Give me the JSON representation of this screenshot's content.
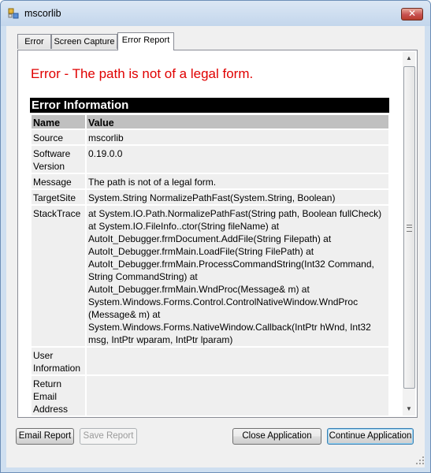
{
  "window": {
    "title": "mscorlib"
  },
  "tabs": [
    {
      "label": "Error"
    },
    {
      "label": "Screen Capture"
    },
    {
      "label": "Error Report"
    }
  ],
  "report": {
    "error_title": "Error - The path is not of a legal form.",
    "section_heading": "Error Information",
    "columns": [
      "Name",
      "Value"
    ],
    "rows": [
      {
        "name": "Source",
        "value": "mscorlib"
      },
      {
        "name": "Software Version",
        "value": "0.19.0.0"
      },
      {
        "name": "Message",
        "value": "The path is not of a legal form."
      },
      {
        "name": "TargetSite",
        "value": "System.String NormalizePathFast(System.String, Boolean)"
      },
      {
        "name": "StackTrace",
        "value": "at System.IO.Path.NormalizePathFast(String path, Boolean fullCheck) at System.IO.FileInfo..ctor(String fileName) at AutoIt_Debugger.frmDocument.AddFile(String Filepath) at AutoIt_Debugger.frmMain.LoadFile(String FilePath) at AutoIt_Debugger.frmMain.ProcessCommandString(Int32 Command, String CommandString) at AutoIt_Debugger.frmMain.WndProc(Message& m) at System.Windows.Forms.Control.ControlNativeWindow.WndProc (Message& m) at System.Windows.Forms.NativeWindow.Callback(IntPtr hWnd, Int32 msg, IntPtr wparam, IntPtr lparam)"
      },
      {
        "name": "User Information",
        "value": ""
      },
      {
        "name": "Return Email Address",
        "value": ""
      }
    ]
  },
  "buttons": {
    "email_report": "Email Report",
    "save_report": "Save Report",
    "close_application": "Close Application",
    "continue_application": "Continue Application"
  },
  "colors": {
    "error_text": "#e00000",
    "heading_bar": "#000000",
    "column_header": "#c0c0c0",
    "row_background": "#efefef"
  },
  "icons": {
    "app": "application-icon",
    "close": "close-icon"
  }
}
